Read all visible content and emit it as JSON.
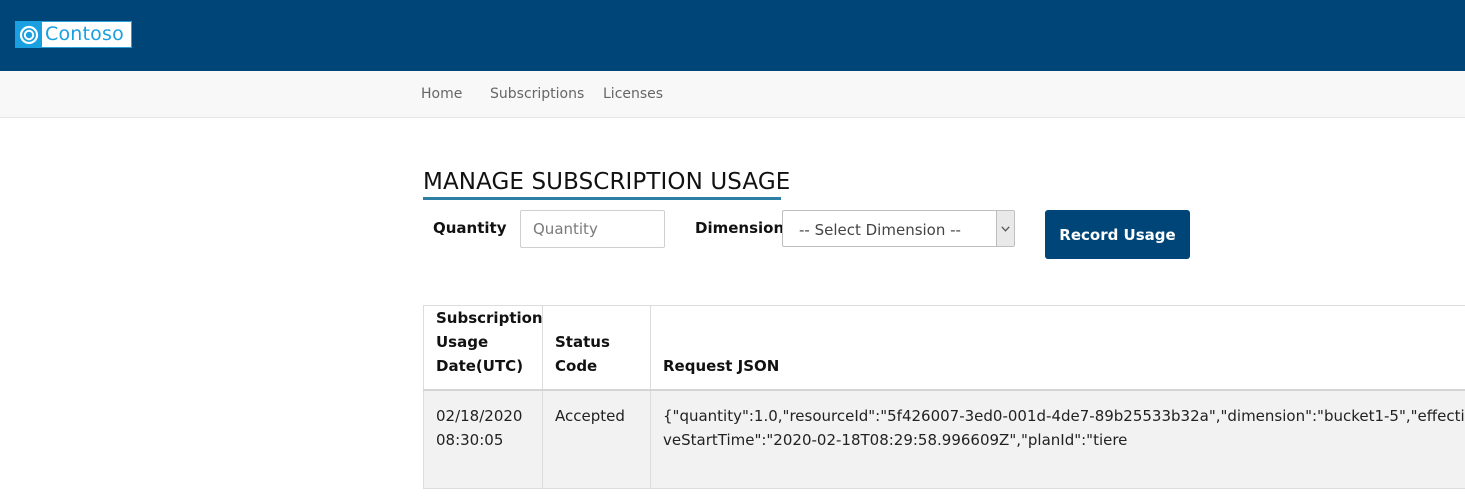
{
  "brand": {
    "name": "Contoso",
    "logo_icon": "contoso-ring-icon",
    "header_color": "#004578",
    "accent_color": "#1a9fe0"
  },
  "nav": {
    "items": [
      {
        "label": "Home"
      },
      {
        "label": "Subscriptions"
      },
      {
        "label": "Licenses"
      }
    ]
  },
  "page": {
    "title": "MANAGE SUBSCRIPTION USAGE"
  },
  "form": {
    "quantity_label": "Quantity",
    "quantity_value": "",
    "quantity_placeholder": "Quantity",
    "dimension_label": "Dimension",
    "dimension_selected": "-- Select Dimension --",
    "record_button_label": "Record Usage"
  },
  "table": {
    "columns": [
      "Subscription Usage Date(UTC)",
      "Status Code",
      "Request JSON"
    ],
    "rows": [
      {
        "date": "02/18/2020 08:30:05",
        "status": "Accepted",
        "request_json": "{\"quantity\":1.0,\"resourceId\":\"5f426007-3ed0-001d-4de7-89b25533b32a\",\"dimension\":\"bucket1-5\",\"effectiveStartTime\":\"2020-02-18T08:29:58.996609Z\",\"planId\":\"tiere"
      }
    ]
  }
}
